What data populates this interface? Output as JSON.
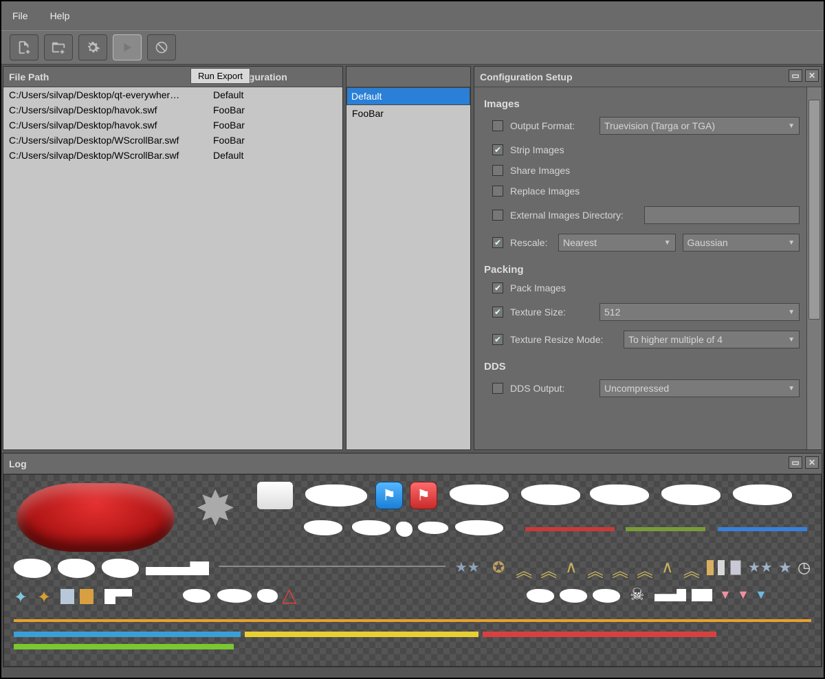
{
  "menubar": {
    "file": "File",
    "help": "Help"
  },
  "toolbar_tooltip": "Run Export",
  "panels": {
    "left_col1": "File Path",
    "left_col2": "Configuration",
    "mid_title": "",
    "right_title": "Configuration Setup",
    "run_export": "Run Export"
  },
  "files": [
    {
      "path": "C:/Users/silvap/Desktop/qt-everywher…",
      "config": "Default"
    },
    {
      "path": "C:/Users/silvap/Desktop/havok.swf",
      "config": "FooBar"
    },
    {
      "path": "C:/Users/silvap/Desktop/havok.swf",
      "config": "FooBar"
    },
    {
      "path": "C:/Users/silvap/Desktop/WScrollBar.swf",
      "config": "FooBar"
    },
    {
      "path": "C:/Users/silvap/Desktop/WScrollBar.swf",
      "config": "Default"
    }
  ],
  "configs": [
    {
      "name": "Default",
      "selected": true
    },
    {
      "name": "FooBar",
      "selected": false
    }
  ],
  "form": {
    "images_title": "Images",
    "output_format_label": "Output Format:",
    "output_format_value": "Truevision (Targa or TGA)",
    "output_format_checked": false,
    "strip_images": "Strip Images",
    "strip_images_checked": true,
    "share_images": "Share Images",
    "share_images_checked": false,
    "replace_images": "Replace Images",
    "replace_images_checked": false,
    "ext_dir_label": "External Images Directory:",
    "ext_dir_checked": false,
    "rescale_label": "Rescale:",
    "rescale_checked": true,
    "rescale_a": "Nearest",
    "rescale_b": "Gaussian",
    "packing_title": "Packing",
    "pack_images": "Pack Images",
    "pack_images_checked": true,
    "texture_size_label": "Texture Size:",
    "texture_size_checked": true,
    "texture_size_value": "512",
    "texture_resize_label": "Texture Resize Mode:",
    "texture_resize_checked": true,
    "texture_resize_value": "To higher multiple of 4",
    "dds_title": "DDS",
    "dds_output_label": "DDS Output:",
    "dds_output_checked": false,
    "dds_output_value": "Uncompressed"
  },
  "log_title": "Log"
}
